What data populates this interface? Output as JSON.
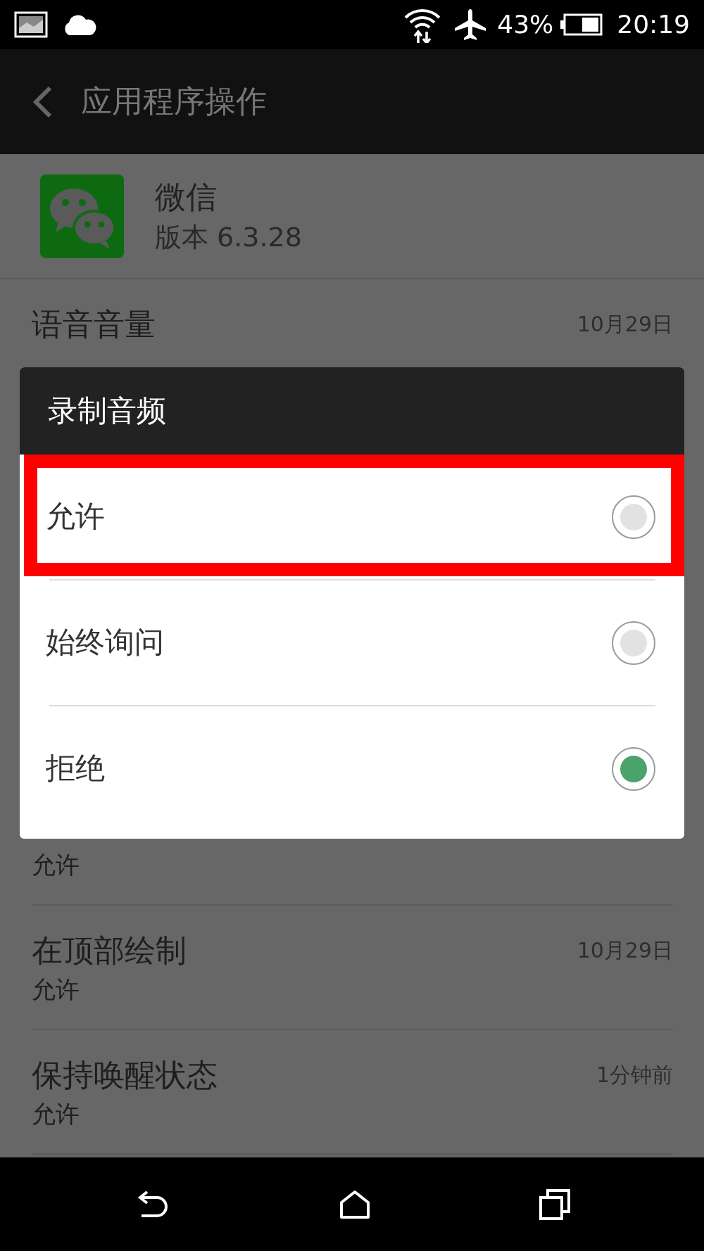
{
  "status_bar": {
    "battery": "43%",
    "time": "20:19"
  },
  "app_bar": {
    "title": "应用程序操作"
  },
  "app": {
    "name": "微信",
    "version": "版本 6.3.28"
  },
  "permissions": [
    {
      "title": "语音音量",
      "date": "10月29日"
    },
    {
      "subtitle": "允许"
    },
    {
      "title": "在顶部绘制",
      "date": "10月29日",
      "subtitle": "允许"
    },
    {
      "title": "保持唤醒状态",
      "date": "1分钟前",
      "subtitle": "允许"
    }
  ],
  "dialog": {
    "title": "录制音频",
    "options": [
      {
        "label": "允许",
        "selected": false,
        "highlighted": true
      },
      {
        "label": "始终询问",
        "selected": false,
        "highlighted": false
      },
      {
        "label": "拒绝",
        "selected": true,
        "highlighted": false
      }
    ]
  }
}
